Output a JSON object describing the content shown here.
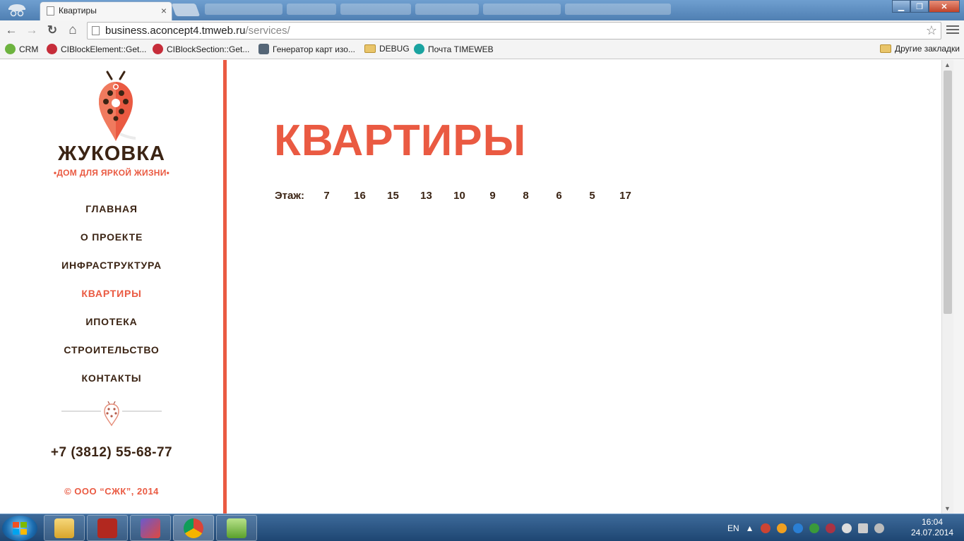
{
  "browser": {
    "tab_title": "Квартиры",
    "tab_close": "×",
    "url_host": "business.aconcept4.tmweb.ru",
    "url_path": "/services/",
    "bookmarks": [
      {
        "label": "CRM",
        "icon": "crm-icon"
      },
      {
        "label": "CIBlockElement::Get...",
        "icon": "bitrix-icon"
      },
      {
        "label": "CIBlockSection::Get...",
        "icon": "bitrix-icon"
      },
      {
        "label": "Генератор карт изо...",
        "icon": "map-icon"
      },
      {
        "label": "DEBUG",
        "icon": "folder-icon"
      },
      {
        "label": "Почта TIMEWEB",
        "icon": "timeweb-icon"
      }
    ],
    "other_bookmarks": "Другие закладки",
    "back": "←",
    "forward": "→",
    "reload": "↻",
    "home": "⌂",
    "star": "☆"
  },
  "site": {
    "brand": "ЖУКОВКА",
    "tagline": "•ДОМ ДЛЯ ЯРКОЙ ЖИЗНИ•",
    "nav": [
      {
        "label": "ГЛАВНАЯ",
        "active": false
      },
      {
        "label": "О ПРОЕКТЕ",
        "active": false
      },
      {
        "label": "ИНФРАСТРУКТУРА",
        "active": false
      },
      {
        "label": "КВАРТИРЫ",
        "active": true
      },
      {
        "label": "ИПОТЕКА",
        "active": false
      },
      {
        "label": "СТРОИТЕЛЬСТВО",
        "active": false
      },
      {
        "label": "КОНТАКТЫ",
        "active": false
      }
    ],
    "phone": "+7 (3812) 55-68-77",
    "copyright": "© ООО “СЖК”, 2014",
    "colors": {
      "accent": "#ea5a42",
      "text_dark": "#3b2414"
    }
  },
  "main": {
    "heading": "КВАРТИРЫ",
    "floors_label": "Этаж:",
    "floors": [
      "7",
      "16",
      "15",
      "13",
      "10",
      "9",
      "8",
      "6",
      "5",
      "17"
    ]
  },
  "taskbar": {
    "lang": "EN",
    "time": "16:04",
    "date": "24.07.2014"
  }
}
